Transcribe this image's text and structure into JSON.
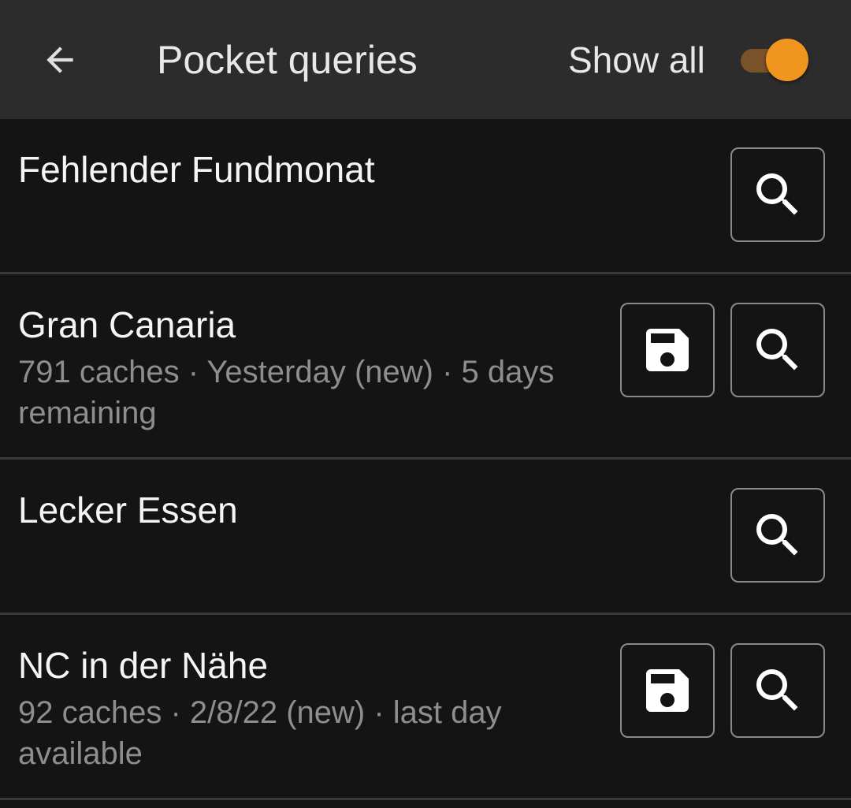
{
  "appbar": {
    "back_icon": "arrow-left-icon",
    "title": "Pocket queries",
    "show_all_label": "Show all",
    "show_all_on": true,
    "accent_color": "#f0961e"
  },
  "queries": [
    {
      "name": "Fehlender Fundmonat",
      "info": "",
      "download": false
    },
    {
      "name": "Gran Canaria",
      "info": "791 caches · Yesterday (new) · 5 days remaining",
      "download": true
    },
    {
      "name": "Lecker Essen",
      "info": "",
      "download": false
    },
    {
      "name": "NC in der Nähe",
      "info": "92 caches · 2/8/22 (new) · last day available",
      "download": true
    }
  ],
  "icons": {
    "download": "save-icon",
    "search": "search-icon"
  }
}
